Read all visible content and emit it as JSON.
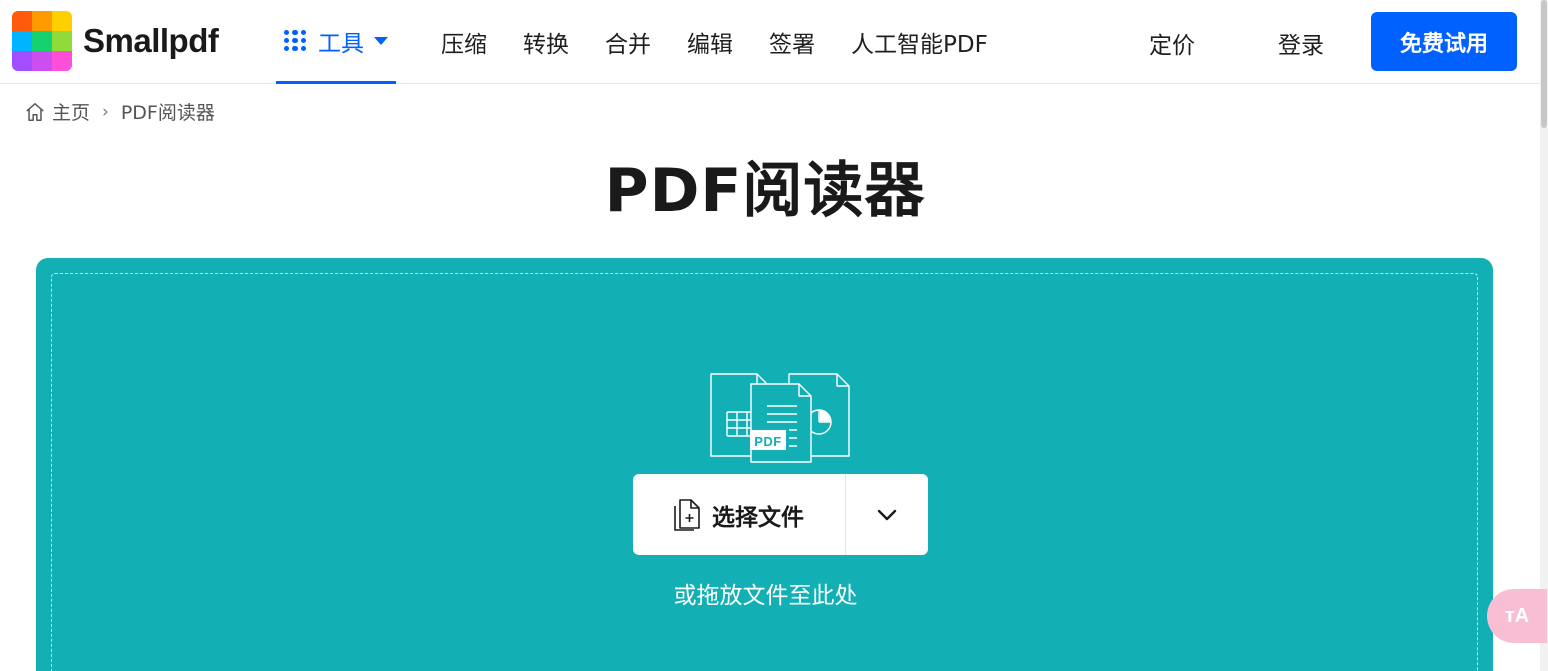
{
  "brand": {
    "name": "Smallpdf",
    "logo_colors": [
      "#ff5b0a",
      "#ff9a00",
      "#ffd000",
      "#00b4ff",
      "#16d26e",
      "#8fdb3a",
      "#a24dff",
      "#cc4ef0",
      "#ff4fd8"
    ]
  },
  "header": {
    "tools_label": "工具",
    "nav": [
      "压缩",
      "转换",
      "合并",
      "编辑",
      "签署",
      "人工智能PDF"
    ],
    "pricing": "定价",
    "login": "登录",
    "trial_button": "免费试用"
  },
  "breadcrumb": {
    "home": "主页",
    "separator": "›",
    "current": "PDF阅读器"
  },
  "page": {
    "title": "PDF阅读器"
  },
  "dropzone": {
    "pdf_badge": "PDF",
    "choose_files": "选择文件",
    "drop_hint": "或拖放文件至此处"
  },
  "translate": {
    "label": "ᴛA"
  },
  "colors": {
    "primary": "#0061fe",
    "dropzone_bg": "#12b0b5"
  }
}
